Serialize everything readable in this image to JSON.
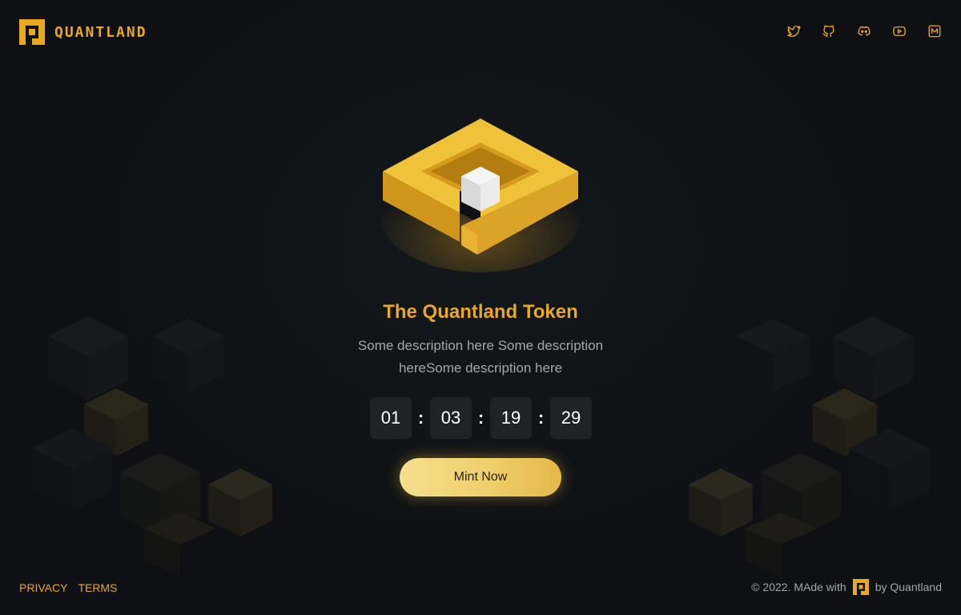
{
  "header": {
    "brand_name": "QUANTLAND",
    "socials": [
      {
        "icon": "twitter-icon"
      },
      {
        "icon": "github-icon"
      },
      {
        "icon": "discord-icon"
      },
      {
        "icon": "youtube-icon"
      },
      {
        "icon": "medium-icon"
      }
    ]
  },
  "hero": {
    "title": "The Quantland Token",
    "description": "Some description here Some description hereSome description here",
    "countdown": {
      "days": "01",
      "hours": "03",
      "minutes": "19",
      "seconds": "29",
      "separator": ":"
    },
    "mint_label": "Mint Now"
  },
  "footer": {
    "privacy": "PRIVACY",
    "terms": "TERMS",
    "copyright_prefix": "© 2022. MAde with",
    "copyright_suffix": "by Quantland"
  },
  "colors": {
    "accent": "#e9a91e",
    "background": "#0e1013",
    "countdown_box": "#1f2328",
    "text_muted": "#a4a6ab"
  }
}
